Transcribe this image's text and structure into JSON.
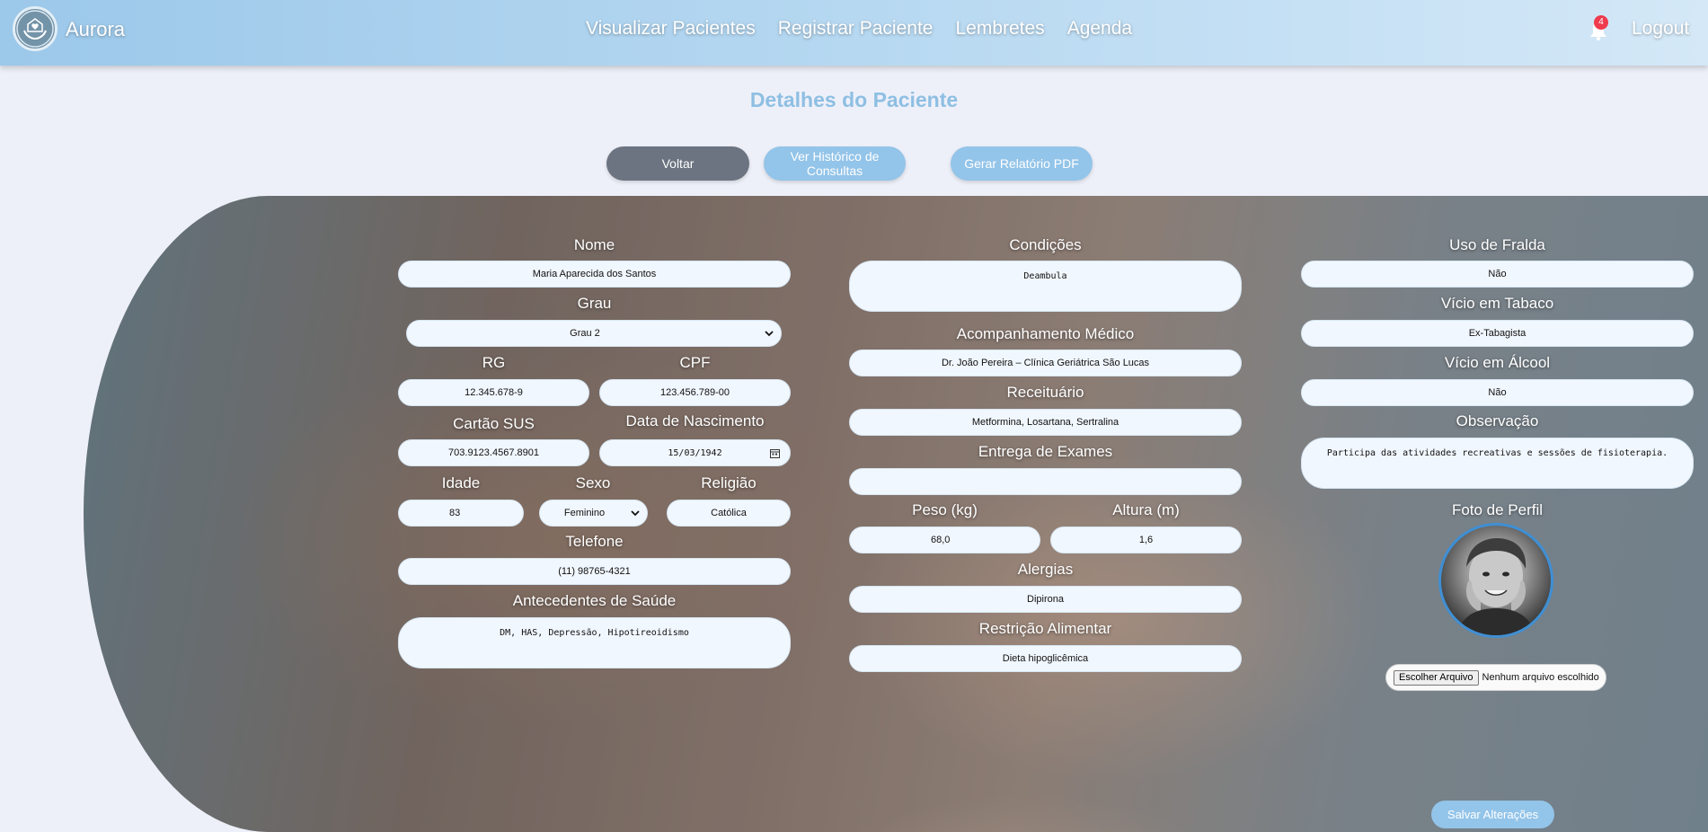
{
  "navbar": {
    "brand": "Aurora",
    "links": [
      "Visualizar Pacientes",
      "Registrar Paciente",
      "Lembretes",
      "Agenda"
    ],
    "notification_count": "4",
    "logout_label": "Logout",
    "bell_icon": "bell-icon",
    "logo_icon": "hands-heart-logo"
  },
  "page": {
    "title": "Detalhes do Paciente"
  },
  "actions": {
    "back": "Voltar",
    "history": "Ver Histórico de Consultas",
    "pdf": "Gerar Relatório PDF",
    "save": "Salvar Alterações"
  },
  "form": {
    "labels": {
      "nome": "Nome",
      "grau": "Grau",
      "rg": "RG",
      "cpf": "CPF",
      "cartao_sus": "Cartão SUS",
      "nascimento": "Data de Nascimento",
      "idade": "Idade",
      "sexo": "Sexo",
      "religiao": "Religião",
      "telefone": "Telefone",
      "antecedentes": "Antecedentes de Saúde",
      "condicoes": "Condições",
      "acompanhamento": "Acompanhamento Médico",
      "receituario": "Receituário",
      "exames": "Entrega de Exames",
      "peso": "Peso (kg)",
      "altura": "Altura (m)",
      "alergias": "Alergias",
      "restricao": "Restrição Alimentar",
      "fralda": "Uso de Fralda",
      "tabaco": "Vício em Tabaco",
      "alcool": "Vício em Álcool",
      "observacao": "Observação",
      "foto": "Foto de Perfil"
    },
    "values": {
      "nome": "Maria Aparecida dos Santos",
      "grau": "Grau 2",
      "rg": "12.345.678-9",
      "cpf": "123.456.789-00",
      "cartao_sus": "703.9123.4567.8901",
      "nascimento": "15/03/1942",
      "idade": "83",
      "sexo": "Feminino",
      "religiao": "Católica",
      "telefone": "(11) 98765-4321",
      "antecedentes": "DM, HAS, Depressão, Hipotireoidismo",
      "condicoes": "Deambula",
      "acompanhamento": "Dr. João Pereira – Clínica Geriátrica São Lucas",
      "receituario": "Metformina, Losartana, Sertralina",
      "exames": "",
      "peso": "68,0",
      "altura": "1,6",
      "alergias": "Dipirona",
      "restricao": "Dieta hipoglicêmica",
      "fralda": "Não",
      "tabaco": "Ex-Tabagista",
      "alcool": "Não",
      "observacao": "Participa das atividades recreativas e sessões de fisioterapia."
    },
    "file_input": {
      "button": "Escolher Arquivo",
      "status": "Nenhum arquivo escolhido"
    }
  },
  "colors": {
    "accent": "#93c4e9",
    "title": "#8ebfe3",
    "back_button": "#6b7480",
    "badge": "#ef3b4d",
    "avatar_border": "#3f8fd4"
  }
}
